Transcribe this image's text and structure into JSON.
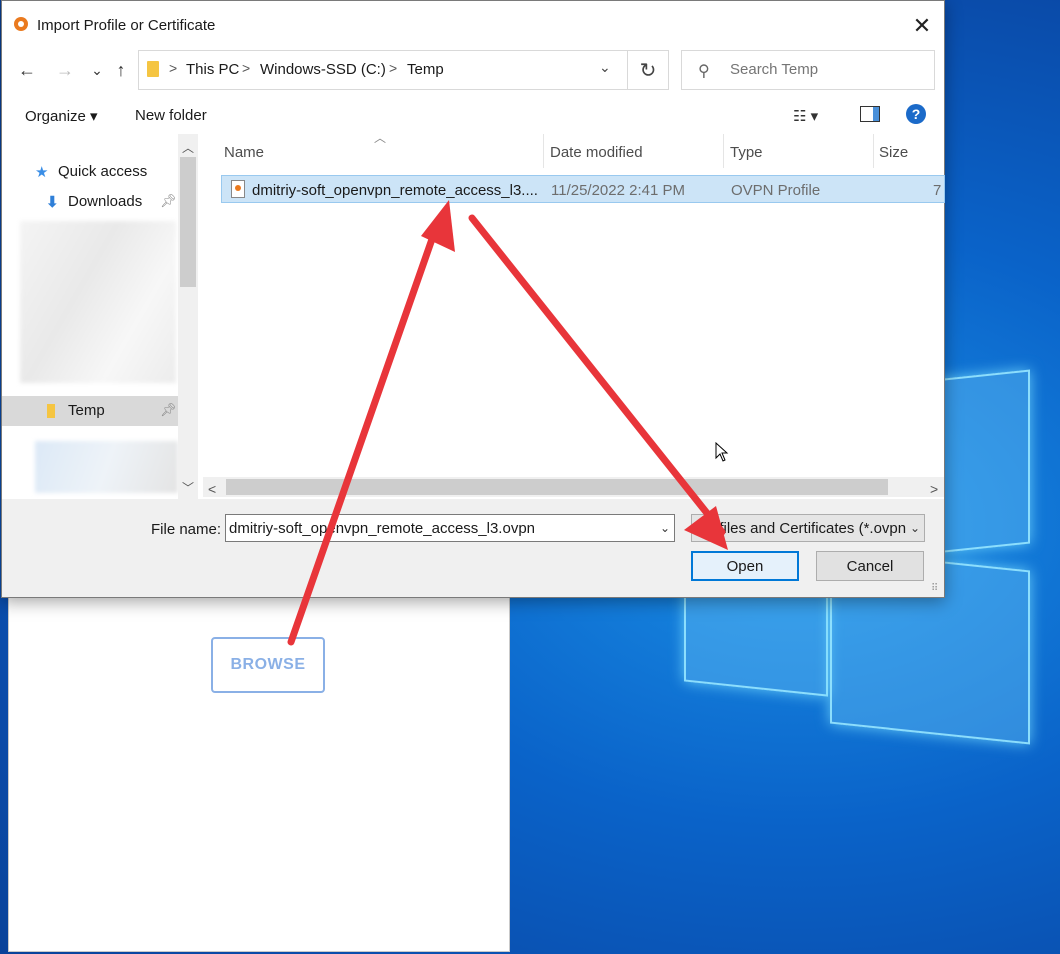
{
  "dialog": {
    "title": "Import Profile or Certificate",
    "close_glyph": "✕"
  },
  "navigation": {
    "back_glyph": "←",
    "forward_glyph": "→",
    "recent_glyph": "⌄",
    "up_glyph": "↑",
    "breadcrumbs": [
      "This PC",
      "Windows-SSD (C:)",
      "Temp"
    ],
    "separator": ">",
    "refresh_glyph": "↻",
    "search_placeholder": "Search Temp"
  },
  "toolbar": {
    "organize_label": "Organize ▾",
    "new_folder_label": "New folder",
    "help_glyph": "?"
  },
  "sidebar": {
    "items": [
      {
        "label": "Quick access",
        "icon": "star-icon"
      },
      {
        "label": "Downloads",
        "icon": "download-icon",
        "pinned": true
      },
      {
        "label": "Temp",
        "icon": "folder-icon",
        "pinned": true,
        "selected": true
      }
    ]
  },
  "file_list": {
    "columns": [
      "Name",
      "Date modified",
      "Type",
      "Size"
    ],
    "rows": [
      {
        "name": "dmitriy-soft_openvpn_remote_access_l3....",
        "date": "11/25/2022 2:41 PM",
        "type": "OVPN Profile",
        "size": "7",
        "selected": true
      }
    ]
  },
  "footer": {
    "file_name_label": "File name:",
    "file_name_value": "dmitriy-soft_openvpn_remote_access_l3.ovpn",
    "file_type_value": "Profiles and Certificates (*.ovpn",
    "open_label": "Open",
    "cancel_label": "Cancel"
  },
  "background_app": {
    "browse_label": "BROWSE"
  },
  "colors": {
    "annotation_arrow": "#e8353a",
    "selection": "#cce4f7",
    "desktop": "#0a63c9"
  }
}
